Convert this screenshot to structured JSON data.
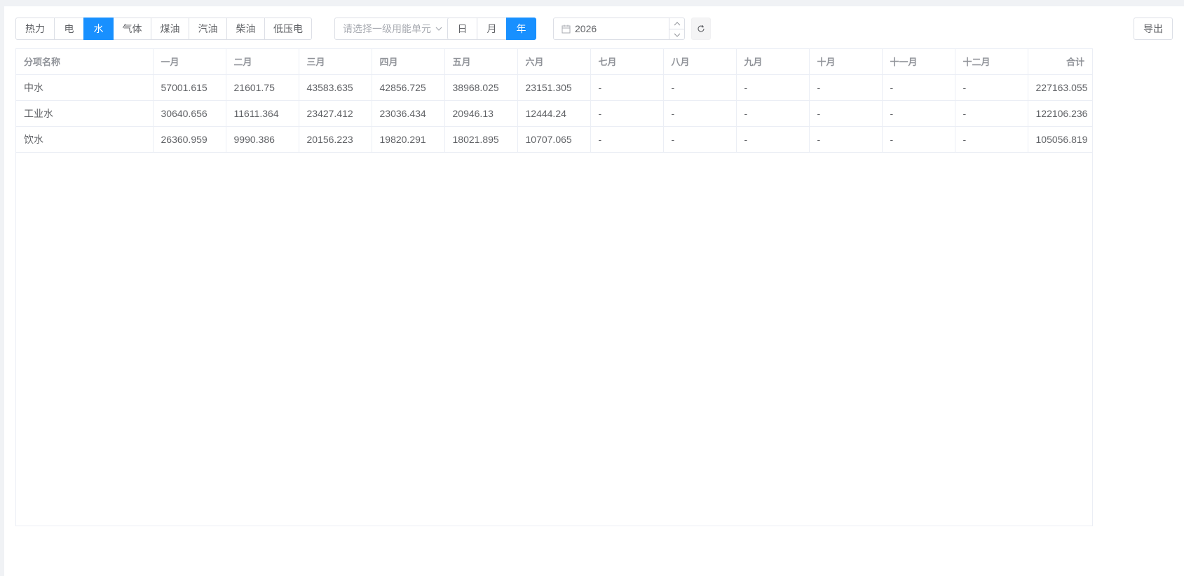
{
  "energy_types": [
    {
      "label": "热力",
      "active": false
    },
    {
      "label": "电",
      "active": false
    },
    {
      "label": "水",
      "active": true
    },
    {
      "label": "气体",
      "active": false
    },
    {
      "label": "煤油",
      "active": false
    },
    {
      "label": "汽油",
      "active": false
    },
    {
      "label": "柴油",
      "active": false
    },
    {
      "label": "低压电",
      "active": false
    }
  ],
  "unit_select": {
    "placeholder": "请选择一级用能单元",
    "icon": "chevron-down-icon"
  },
  "period_types": [
    {
      "label": "日",
      "active": false
    },
    {
      "label": "月",
      "active": false
    },
    {
      "label": "年",
      "active": true
    }
  ],
  "date_picker": {
    "value": "2026",
    "icon": "calendar-icon"
  },
  "refresh": {
    "icon": "refresh-icon"
  },
  "export_label": "导出",
  "colors": {
    "accent": "#1890ff",
    "border": "#dcdfe6",
    "header_text": "#909399"
  },
  "table": {
    "columns": [
      "分项名称",
      "一月",
      "二月",
      "三月",
      "四月",
      "五月",
      "六月",
      "七月",
      "八月",
      "九月",
      "十月",
      "十一月",
      "十二月",
      "合计"
    ],
    "rows": [
      [
        "中水",
        "57001.615",
        "21601.75",
        "43583.635",
        "42856.725",
        "38968.025",
        "23151.305",
        "-",
        "-",
        "-",
        "-",
        "-",
        "-",
        "227163.055"
      ],
      [
        "工业水",
        "30640.656",
        "11611.364",
        "23427.412",
        "23036.434",
        "20946.13",
        "12444.24",
        "-",
        "-",
        "-",
        "-",
        "-",
        "-",
        "122106.236"
      ],
      [
        "饮水",
        "26360.959",
        "9990.386",
        "20156.223",
        "19820.291",
        "18021.895",
        "10707.065",
        "-",
        "-",
        "-",
        "-",
        "-",
        "-",
        "105056.819"
      ]
    ]
  }
}
